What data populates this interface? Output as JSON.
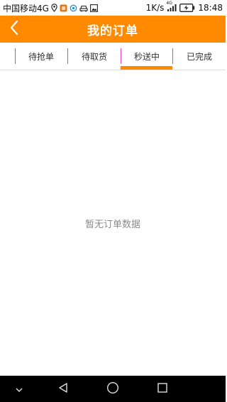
{
  "status_bar": {
    "carrier": "中国移动4G",
    "speed": "1K/s",
    "network_badge": "4G",
    "time": "18:48",
    "icons": [
      "location-icon",
      "app-notification-icon",
      "sync-icon",
      "car-icon",
      "image-icon",
      "signal-icon",
      "battery-charging-icon"
    ]
  },
  "header": {
    "title": "我的订单",
    "back_icon": "chevron-left-icon",
    "background_color": "#ff8a00"
  },
  "tabs": [
    {
      "label": "待抢单",
      "selected": false
    },
    {
      "label": "待取货",
      "selected": false
    },
    {
      "label": "秒送中",
      "selected": true
    },
    {
      "label": "已完成",
      "selected": false
    }
  ],
  "tab_accent_color": "#ff8a00",
  "tab_divider_color": "#e040c8",
  "content": {
    "empty_message": "暂无订单数据"
  },
  "nav_bar": {
    "buttons": [
      "collapse-icon",
      "back-triangle-icon",
      "home-circle-icon",
      "recents-square-icon"
    ]
  }
}
